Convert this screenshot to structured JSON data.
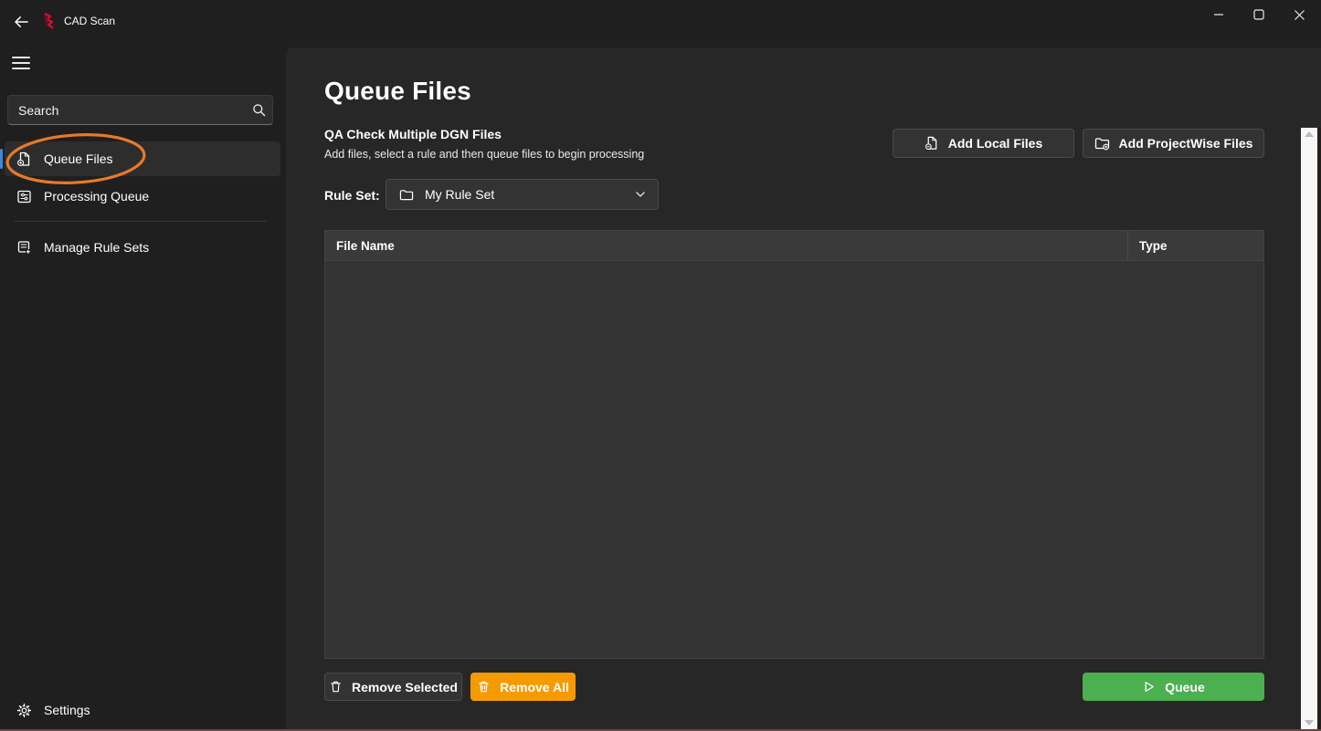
{
  "colors": {
    "accent_blue": "#4088d4",
    "queue_green": "#4caf50",
    "remove_all_orange": "#f59b00",
    "annotation_orange": "#e8792a",
    "logo_red": "#c8102e"
  },
  "titlebar": {
    "app_title": "CAD Scan"
  },
  "sidebar": {
    "search_placeholder": "Search",
    "nav_items": [
      {
        "label": "Queue Files",
        "selected": true,
        "icon": "document-add-icon"
      },
      {
        "label": "Processing Queue",
        "selected": false,
        "icon": "processing-list-icon"
      },
      {
        "label": "Manage Rule Sets",
        "selected": false,
        "icon": "rule-sets-icon"
      }
    ],
    "settings_label": "Settings"
  },
  "main": {
    "page_title": "Queue Files",
    "section_title": "QA Check Multiple DGN Files",
    "section_description": "Add files, select a rule and then queue files to begin processing",
    "buttons": {
      "add_local": "Add Local Files",
      "add_projectwise": "Add ProjectWise Files",
      "remove_selected": "Remove Selected",
      "remove_all": "Remove All",
      "queue": "Queue"
    },
    "rule_set": {
      "label": "Rule Set:",
      "selected_value": "My Rule Set"
    },
    "table": {
      "columns": [
        "File Name",
        "Type"
      ],
      "rows": []
    }
  },
  "annotation": {
    "shape": "ellipse",
    "target": "Queue Files nav item",
    "color": "#e8792a"
  }
}
